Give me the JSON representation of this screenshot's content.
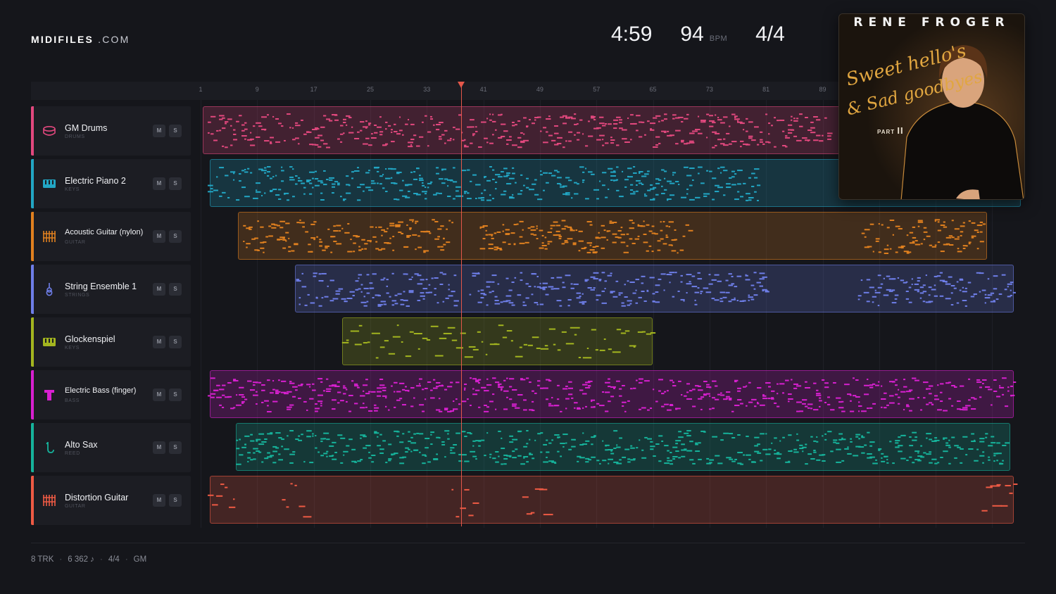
{
  "brand": {
    "name_bold": "MIDIFILES",
    "name_light": ".COM"
  },
  "transport": {
    "duration": "4:59",
    "tempo": "94",
    "tempo_unit": "BPM",
    "time_signature": "4/4"
  },
  "ruler": {
    "bar_labels": [
      "1",
      "9",
      "17",
      "25",
      "33",
      "41",
      "49",
      "57",
      "65",
      "73",
      "81",
      "89"
    ]
  },
  "playhead": {
    "bar": 37
  },
  "tracks": [
    {
      "name": "GM Drums",
      "category": "DRUMS",
      "color": "#e2487e",
      "icon": "drum-icon",
      "mute": "M",
      "solo": "S"
    },
    {
      "name": "Electric Piano 2",
      "category": "KEYS",
      "color": "#22a6c4",
      "icon": "keyboard-icon",
      "mute": "M",
      "solo": "S"
    },
    {
      "name": "Acoustic Guitar (nylon)",
      "category": "GUITAR",
      "color": "#e0801f",
      "icon": "guitar-fretboard-icon",
      "mute": "M",
      "solo": "S"
    },
    {
      "name": "String Ensemble 1",
      "category": "STRINGS",
      "color": "#6e7ee8",
      "icon": "violin-icon",
      "mute": "M",
      "solo": "S"
    },
    {
      "name": "Glockenspiel",
      "category": "KEYS",
      "color": "#a3b51f",
      "icon": "keyboard-icon",
      "mute": "M",
      "solo": "S"
    },
    {
      "name": "Electric Bass (finger)",
      "category": "BASS",
      "color": "#d820d0",
      "icon": "bass-icon",
      "mute": "M",
      "solo": "S"
    },
    {
      "name": "Alto Sax",
      "category": "REED",
      "color": "#16b39b",
      "icon": "saxophone-icon",
      "mute": "M",
      "solo": "S"
    },
    {
      "name": "Distortion Guitar",
      "category": "GUITAR",
      "color": "#ee5a44",
      "icon": "guitar-fretboard-icon",
      "mute": "M",
      "solo": "S"
    }
  ],
  "footer": {
    "tracks": "8 TRK",
    "notes": "6 362 ♪",
    "time_signature": "4/4",
    "standard": "GM"
  },
  "album_cover": {
    "artist": "RENE FROGER",
    "title_line1": "Sweet hello's",
    "title_line2": "& Sad goodbyes",
    "part_label": "PART",
    "part_number": "II"
  }
}
